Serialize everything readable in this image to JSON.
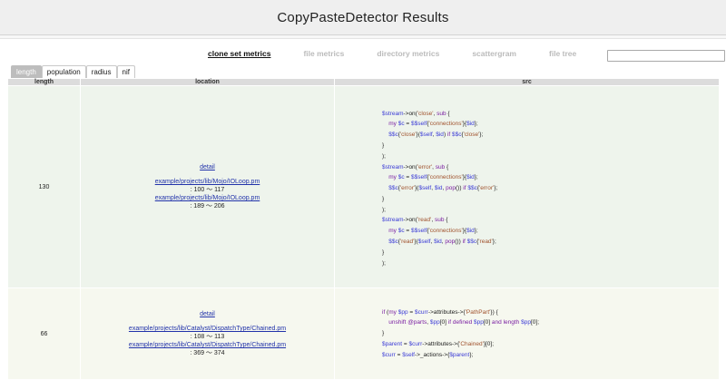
{
  "title": "CopyPasteDetector Results",
  "nav": {
    "items": [
      {
        "label": "clone set metrics",
        "active": true
      },
      {
        "label": "file metrics",
        "active": false
      },
      {
        "label": "directory metrics",
        "active": false
      },
      {
        "label": "scattergram",
        "active": false
      },
      {
        "label": "file tree",
        "active": false
      }
    ]
  },
  "search": {
    "value": "",
    "placeholder": ""
  },
  "tabs": [
    {
      "label": "length",
      "active": true
    },
    {
      "label": "population",
      "active": false
    },
    {
      "label": "radius",
      "active": false
    },
    {
      "label": "nif",
      "active": false
    }
  ],
  "table": {
    "headers": {
      "length": "length",
      "location": "location",
      "src": "src"
    },
    "rows": [
      {
        "length": "130",
        "detail": "detail",
        "locations": [
          {
            "path": "example/projects/lib/Mojo/IOLoop.pm",
            "range": ": 100 ～ 117"
          },
          {
            "path": "example/projects/lib/Mojo/IOLoop.pm",
            "range": ": 189 ～ 206"
          }
        ],
        "src": [
          "$stream->on('close', sub {",
          "    my $c = $$self{'connections'}{$id};",
          "    $$c{'close'}($self, $id) if $$c{'close'};",
          "}",
          ");",
          "$stream->on('error', sub {",
          "    my $c = $$self{'connections'}{$id};",
          "    $$c{'error'}($self, $id, pop()) if $$c{'error'};",
          "}",
          ");",
          "$stream->on('read', sub {",
          "    my $c = $$self{'connections'}{$id};",
          "    $$c{'read'}($self, $id, pop()) if $$c{'read'};",
          "}",
          ");"
        ]
      },
      {
        "length": "66",
        "detail": "detail",
        "locations": [
          {
            "path": "example/projects/lib/Catalyst/DispatchType/Chained.pm",
            "range": ": 108 ～ 113"
          },
          {
            "path": "example/projects/lib/Catalyst/DispatchType/Chained.pm",
            "range": ": 369 ～ 374"
          }
        ],
        "src": [
          "if (my $pp = $curr->attributes->{'PathPart'}) {",
          "    unshift @parts, $pp[0] if defined $pp[0] and length $pp[0];",
          "}",
          "$parent = $curr->attributes->{'Chained'}[0];",
          "$curr = $self->_actions->{$parent};"
        ]
      }
    ]
  }
}
